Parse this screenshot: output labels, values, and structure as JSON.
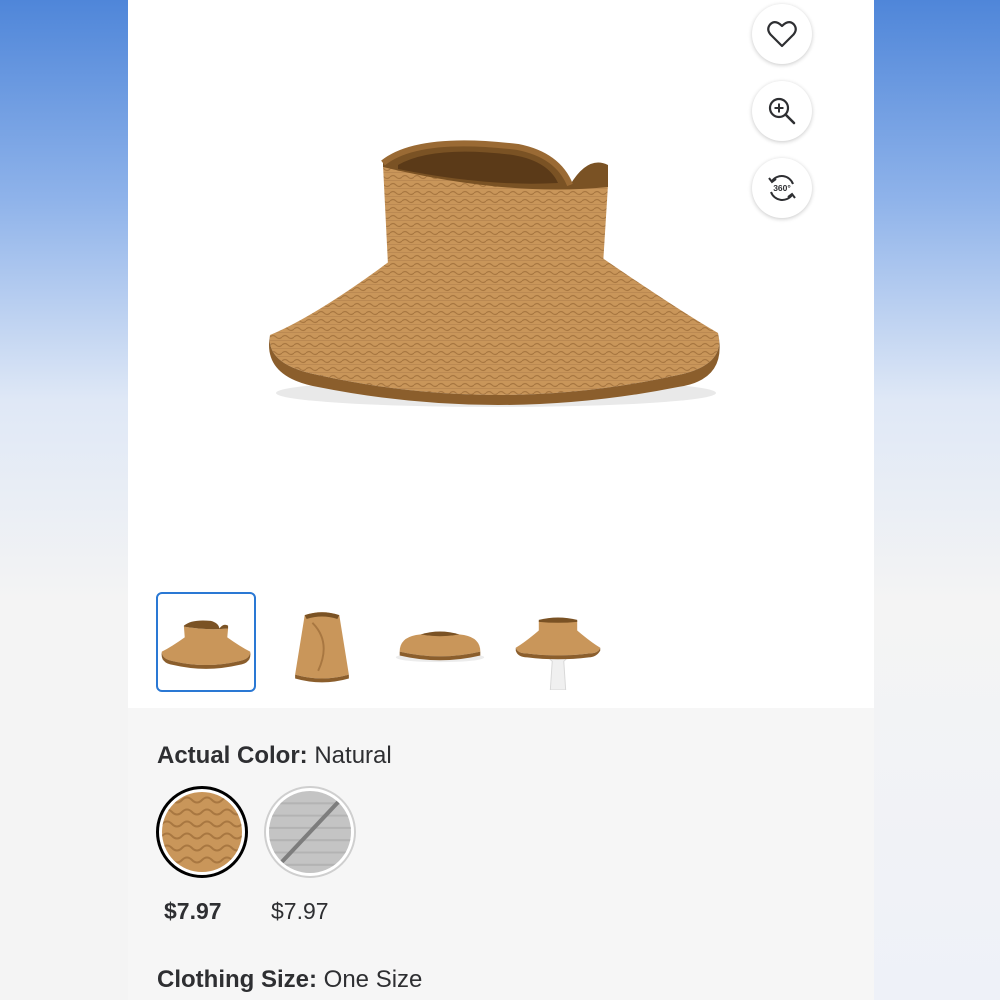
{
  "icons": {
    "favorite": "heart-icon",
    "zoom": "zoom-in-icon",
    "view360": "360-view-icon"
  },
  "view360_label": "360°",
  "colors": {
    "accent": "#2a78d4",
    "straw": "#c9965a",
    "trim": "#8b5e2c"
  },
  "thumbnails": [
    {
      "name": "thumb-visor-front",
      "selected": true
    },
    {
      "name": "thumb-visor-rolled",
      "selected": false
    },
    {
      "name": "thumb-visor-flat",
      "selected": false
    },
    {
      "name": "thumb-visor-mannequin",
      "selected": false
    }
  ],
  "color_option": {
    "label": "Actual Color:",
    "value": "Natural",
    "options": [
      {
        "name": "Natural",
        "price": "$7.97",
        "selected": true,
        "available": true
      },
      {
        "name": "Gray",
        "price": "$7.97",
        "selected": false,
        "available": false
      }
    ]
  },
  "size_option": {
    "label": "Clothing Size:",
    "value": "One Size"
  }
}
